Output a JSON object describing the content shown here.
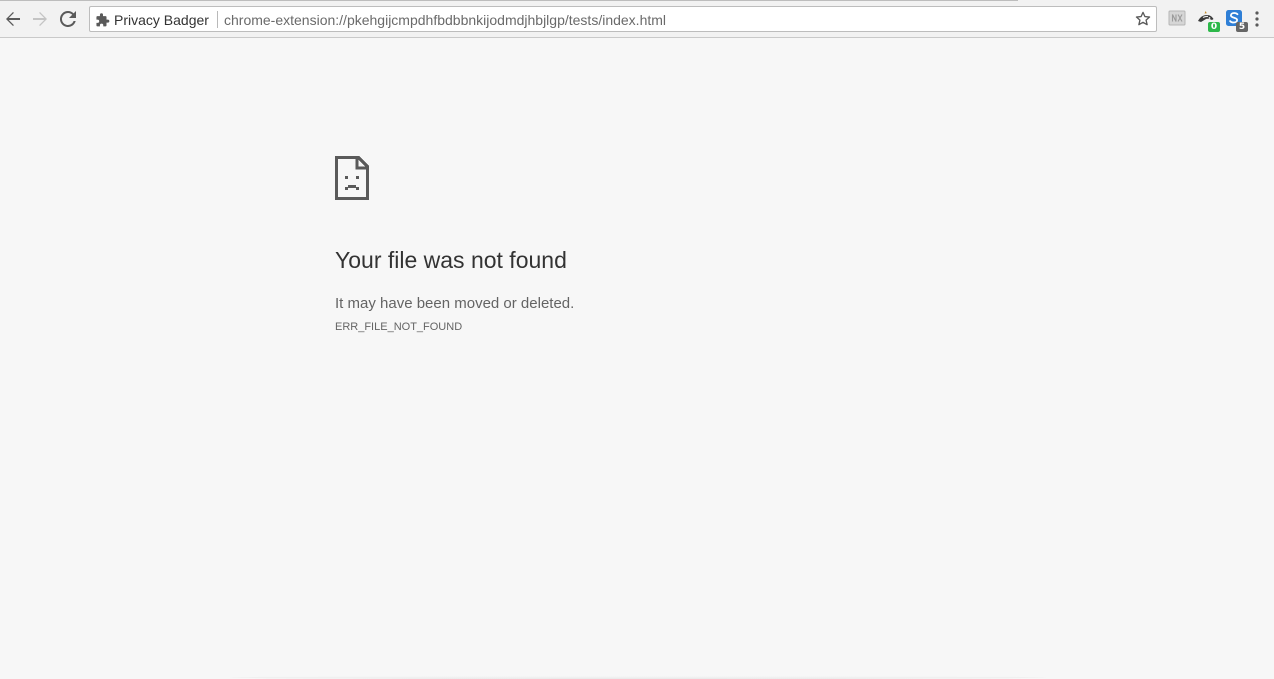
{
  "browser": {
    "site_chip_label": "Privacy Badger",
    "url": "chrome-extension://pkehgijcmpdhfbdbbnkijodmdjhbjlgp/tests/index.html",
    "icons": {
      "back": "arrow-left-icon",
      "forward": "arrow-right-icon",
      "reload": "reload-icon",
      "site": "puzzle-piece-icon",
      "bookmark": "star-icon",
      "menu": "kebab-menu-icon"
    },
    "extensions": [
      {
        "name": "nx-extension-icon",
        "badge": ""
      },
      {
        "name": "privacy-badger-icon",
        "badge": "0",
        "badge_color": "#2db84a"
      },
      {
        "name": "https-extension-icon",
        "badge": "5",
        "badge_color": "#666666"
      }
    ]
  },
  "error_page": {
    "icon": "sad-file-icon",
    "title": "Your file was not found",
    "description": "It may have been moved or deleted.",
    "code": "ERR_FILE_NOT_FOUND"
  },
  "colors": {
    "page_background": "#f7f7f7",
    "toolbar_background": "#f2f2f2",
    "title_text": "#333333",
    "body_text": "#646464"
  }
}
